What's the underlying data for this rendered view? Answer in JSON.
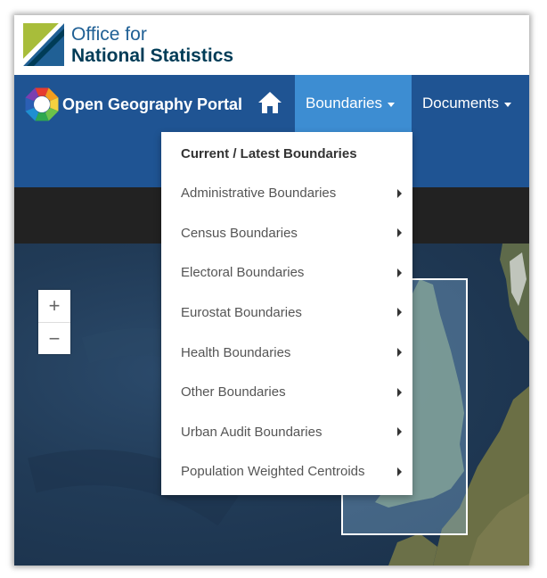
{
  "ons": {
    "line1": "Office for",
    "line2": "National Statistics"
  },
  "navbar": {
    "portal_title": "Open Geography Portal",
    "boundaries_label": "Boundaries",
    "documents_label": "Documents"
  },
  "dropdown": {
    "items": [
      {
        "label": "Current / Latest Boundaries",
        "submenu": false
      },
      {
        "label": "Administrative Boundaries",
        "submenu": true
      },
      {
        "label": "Census Boundaries",
        "submenu": true
      },
      {
        "label": "Electoral Boundaries",
        "submenu": true
      },
      {
        "label": "Eurostat Boundaries",
        "submenu": true
      },
      {
        "label": "Health Boundaries",
        "submenu": true
      },
      {
        "label": "Other Boundaries",
        "submenu": true
      },
      {
        "label": "Urban Audit Boundaries",
        "submenu": true
      },
      {
        "label": "Population Weighted Centroids",
        "submenu": true
      }
    ]
  },
  "map": {
    "zoom_in": "+",
    "zoom_out": "−"
  },
  "colors": {
    "ons_blue": "#206095",
    "navbar": "#1f5493",
    "nav_active": "#3d8dd2",
    "black_bar": "#222222"
  }
}
